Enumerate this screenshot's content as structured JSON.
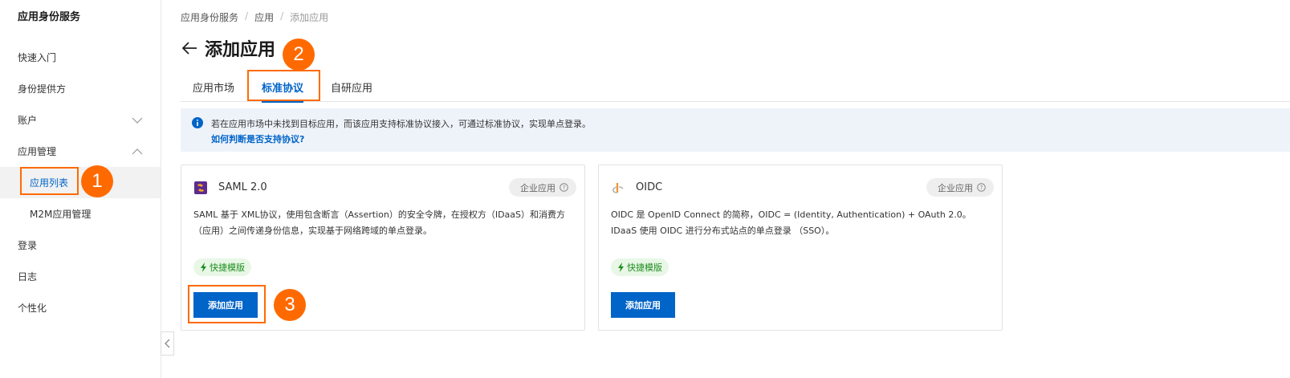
{
  "sidebar": {
    "title": "应用身份服务",
    "items": [
      {
        "label": "快速入门"
      },
      {
        "label": "身份提供方"
      },
      {
        "label": "账户"
      },
      {
        "label": "应用管理"
      },
      {
        "label": "应用列表"
      },
      {
        "label": "M2M应用管理"
      },
      {
        "label": "登录"
      },
      {
        "label": "日志"
      },
      {
        "label": "个性化"
      }
    ]
  },
  "breadcrumb": [
    "应用身份服务",
    "/",
    "应用",
    "/",
    "添加应用"
  ],
  "page": {
    "title": "添加应用"
  },
  "tabs": [
    {
      "label": "应用市场"
    },
    {
      "label": "标准协议"
    },
    {
      "label": "自研应用"
    }
  ],
  "notice": {
    "text": "若在应用市场中未找到目标应用，而该应用支持标准协议接入，可通过标准协议，实现单点登录。",
    "link": "如何判断是否支持协议?"
  },
  "cards": [
    {
      "name": "SAML 2.0",
      "badge": "企业应用",
      "desc": "SAML 基于 XML协议，使用包含断言（Assertion）的安全令牌，在授权方（IDaaS）和消费方（应用）之间传递身份信息，实现基于网络跨域的单点登录。",
      "tag": "快捷模版",
      "button": "添加应用"
    },
    {
      "name": "OIDC",
      "badge": "企业应用",
      "desc": "OIDC 是 OpenID Connect 的简称，OIDC = (Identity, Authentication) + OAuth 2.0。IDaaS 使用 OIDC 进行分布式站点的单点登录 （SSO）。",
      "tag": "快捷模版",
      "button": "添加应用"
    }
  ],
  "annotations": [
    "1",
    "2",
    "3"
  ],
  "colors": {
    "accent": "#0064c8",
    "highlight": "#ff6a00",
    "tag_green": "#1e8e1e"
  }
}
